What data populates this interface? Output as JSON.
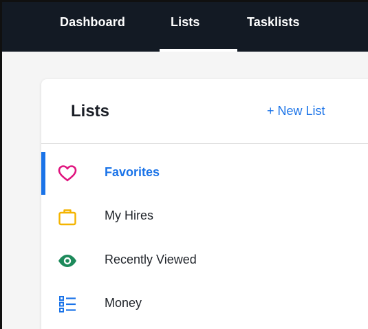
{
  "nav": {
    "tabs": [
      {
        "label": "Dashboard"
      },
      {
        "label": "Lists"
      },
      {
        "label": "Tasklists"
      }
    ],
    "active_tab": "Lists"
  },
  "lists_panel": {
    "title": "Lists",
    "new_list_label": "+ New List",
    "items": [
      {
        "label": "Favorites",
        "icon": "heart-icon",
        "active": true
      },
      {
        "label": "My Hires",
        "icon": "briefcase-icon",
        "active": false
      },
      {
        "label": "Recently Viewed",
        "icon": "eye-icon",
        "active": false
      },
      {
        "label": "Money",
        "icon": "list-icon",
        "active": false
      }
    ]
  },
  "colors": {
    "nav_background": "#131a24",
    "accent_blue": "#1a73e8",
    "heart": "#e0157f",
    "briefcase": "#f4b400",
    "eye": "#1d8a5b",
    "list_icon": "#1a73e8"
  }
}
